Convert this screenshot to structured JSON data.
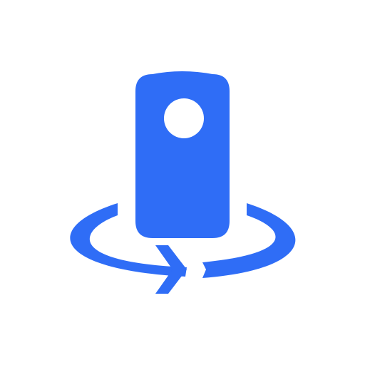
{
  "icon": {
    "name": "360-camera-rotate-icon",
    "color": "#2f6df6",
    "background": "#ffffff"
  }
}
